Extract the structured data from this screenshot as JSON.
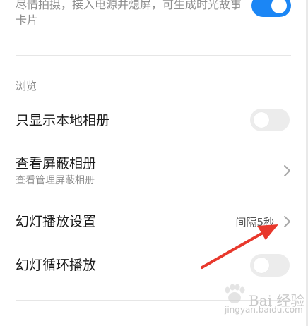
{
  "story_card": {
    "description_line1": "尽情拍摄，接入电源并熄屏，可生成时光故事",
    "description_line2": "卡片",
    "toggle_state": "on"
  },
  "browse_section": {
    "title": "浏览",
    "items": [
      {
        "title": "只显示本地相册",
        "type": "toggle",
        "state": "off"
      },
      {
        "title": "查看屏蔽相册",
        "subtitle": "查看管理屏蔽相册",
        "type": "link"
      },
      {
        "title": "幻灯播放设置",
        "value": "间隔5秒",
        "type": "link"
      },
      {
        "title": "幻灯循环播放",
        "type": "toggle",
        "state": "off"
      }
    ]
  },
  "colors": {
    "accent": "#1b86f5",
    "annotation_arrow": "#e8382c",
    "toggle_off": "#ececec"
  },
  "watermark": {
    "text": "Bai 经验",
    "url": "jingyan.baidu.com"
  }
}
